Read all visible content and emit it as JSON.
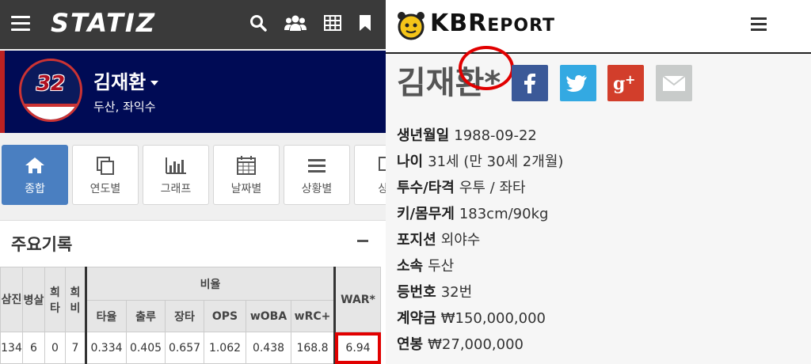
{
  "left": {
    "logo": "STATIZ",
    "player": {
      "number": "32",
      "name": "김재환",
      "team_position": "두산, 좌익수"
    },
    "tabs": [
      {
        "label": "종합",
        "icon": "home-icon",
        "active": true
      },
      {
        "label": "연도별",
        "icon": "copy-icon",
        "active": false
      },
      {
        "label": "그래프",
        "icon": "bar-chart-icon",
        "active": false
      },
      {
        "label": "날짜별",
        "icon": "calendar-icon",
        "active": false
      },
      {
        "label": "상황별",
        "icon": "list-icon",
        "active": false
      },
      {
        "label": "상H",
        "icon": "copy-icon",
        "active": false
      }
    ],
    "section_title": "주요기록",
    "table": {
      "group_header": "비율",
      "left_headers": [
        "삼진",
        "병살",
        "희타",
        "희비"
      ],
      "rate_headers": [
        "타율",
        "출루",
        "장타",
        "OPS",
        "wOBA",
        "wRC+"
      ],
      "war_header": "WAR*",
      "row": {
        "left": [
          "134",
          "6",
          "0",
          "7"
        ],
        "rates": [
          "0.334",
          "0.405",
          "0.657",
          "1.062",
          "0.438",
          "168.8"
        ],
        "war": "6.94"
      }
    }
  },
  "right": {
    "logo_big": "KBR",
    "logo_small": "EPORT",
    "name": "김재환*",
    "share": [
      "facebook-icon",
      "twitter-icon",
      "google-plus-icon",
      "email-icon"
    ],
    "info": [
      {
        "key": "생년월일",
        "value": "1988-09-22"
      },
      {
        "key": "나이",
        "value": "31세 (만 30세 2개월)"
      },
      {
        "key": "투수/타격",
        "value": "우투 / 좌타"
      },
      {
        "key": "키/몸무게",
        "value": "183cm/90kg"
      },
      {
        "key": "포지션",
        "value": "외야수"
      },
      {
        "key": "소속",
        "value": "두산"
      },
      {
        "key": "등번호",
        "value": "32번"
      },
      {
        "key": "계약금",
        "value": "₩150,000,000"
      },
      {
        "key": "연봉",
        "value": "₩27,000,000"
      }
    ]
  },
  "colors": {
    "statiz_topbar": "#3a3a3a",
    "player_header": "#000b55",
    "tab_active": "#4a7fc1",
    "highlight_red": "#e10000",
    "facebook": "#3b5998",
    "twitter": "#33a9e2",
    "google_plus": "#d23e2b",
    "email": "#c8cbca"
  }
}
